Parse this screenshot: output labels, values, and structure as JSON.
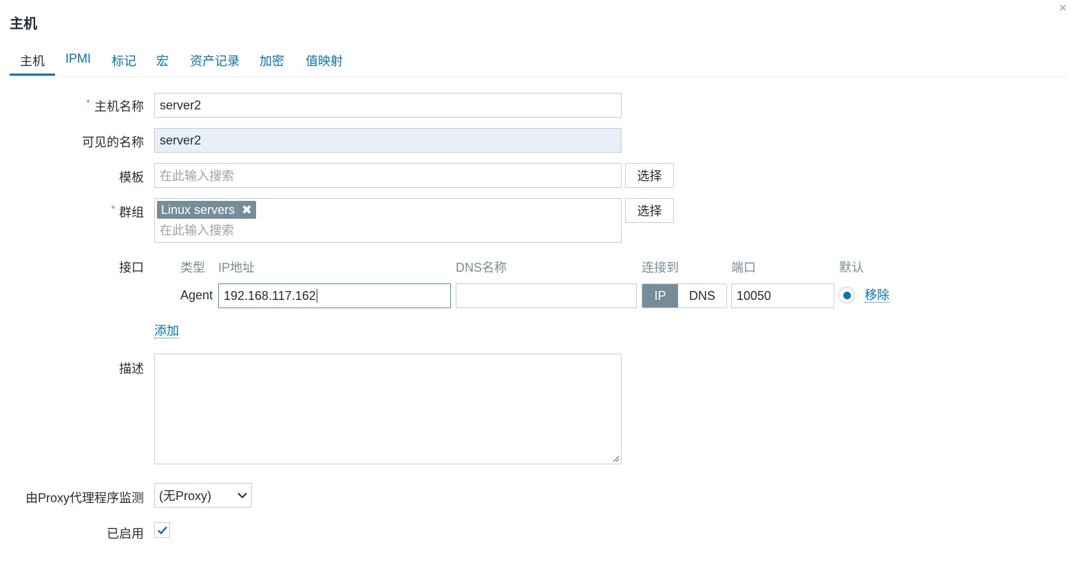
{
  "dialog": {
    "title": "主机",
    "close_icon": "×"
  },
  "tabs": [
    {
      "label": "主机",
      "active": true
    },
    {
      "label": "IPMI"
    },
    {
      "label": "标记"
    },
    {
      "label": "宏"
    },
    {
      "label": "资产记录"
    },
    {
      "label": "加密"
    },
    {
      "label": "值映射"
    }
  ],
  "form": {
    "host_name": {
      "label": "主机名称",
      "required_mark": "*",
      "value": "server2"
    },
    "visible_name": {
      "label": "可见的名称",
      "value": "server2"
    },
    "templates": {
      "label": "模板",
      "placeholder": "在此输入搜索",
      "select_button": "选择"
    },
    "groups": {
      "label": "群组",
      "required_mark": "*",
      "tags": [
        "Linux servers"
      ],
      "tag_remove_icon": "✖",
      "placeholder": "在此输入搜索",
      "select_button": "选择"
    },
    "interfaces": {
      "label": "接口",
      "headers": {
        "type": "类型",
        "ip": "IP地址",
        "dns": "DNS名称",
        "connect_to": "连接到",
        "port": "端口",
        "default": "默认"
      },
      "rows": [
        {
          "type": "Agent",
          "ip": "192.168.117.162",
          "dns": "",
          "connect_options": [
            "IP",
            "DNS"
          ],
          "connect_selected": "IP",
          "port": "10050",
          "default": true,
          "remove_link": "移除"
        }
      ],
      "add_link": "添加"
    },
    "description": {
      "label": "描述",
      "value": ""
    },
    "proxy": {
      "label": "由Proxy代理程序监测",
      "selected": "(无Proxy)"
    },
    "enabled": {
      "label": "已启用",
      "checked": true
    }
  },
  "colors": {
    "link": "#0275b8",
    "text": "#1f2c33",
    "required": "#e45959",
    "toggle_active": "#768d99",
    "readonly_bg": "#e8eff9"
  }
}
